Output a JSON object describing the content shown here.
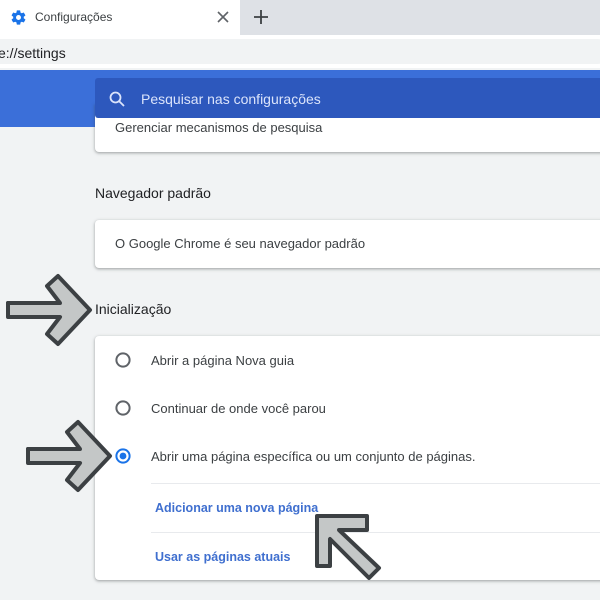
{
  "tab": {
    "title": "Configurações",
    "icon": "gear-icon"
  },
  "toolbar": {
    "url": "e://settings"
  },
  "search": {
    "placeholder": "Pesquisar nas configurações",
    "icon": "search-icon"
  },
  "top_card": {
    "text": "Gerenciar mecanismos de pesquisa"
  },
  "default_browser": {
    "heading": "Navegador padrão",
    "text": "O Google Chrome é seu navegador padrão"
  },
  "startup": {
    "heading": "Inicialização",
    "options": [
      {
        "label": "Abrir a página Nova guia",
        "selected": false
      },
      {
        "label": "Continuar de onde você parou",
        "selected": false
      },
      {
        "label": "Abrir uma página específica ou um conjunto de páginas.",
        "selected": true
      }
    ],
    "links": {
      "add_page": "Adicionar uma nova página",
      "use_current": "Usar as páginas atuais"
    }
  },
  "colors": {
    "header_blue": "#3b6fd9",
    "search_blue": "#2d58bd",
    "radio_selected": "#1a73e8",
    "link": "#3f6fcf"
  },
  "annotations": [
    "arrow-right-icon",
    "arrow-right-icon",
    "arrow-up-left-icon"
  ]
}
